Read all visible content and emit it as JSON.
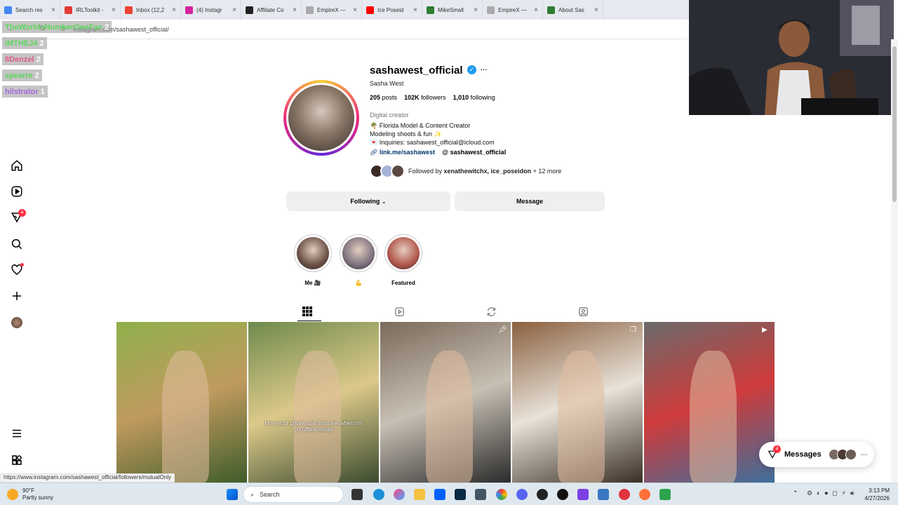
{
  "browser": {
    "tabs": [
      {
        "title": "Search res",
        "color": "#4285f4"
      },
      {
        "title": "IRLToolkit -",
        "color": "#e53935"
      },
      {
        "title": "Inbox (12,2",
        "color": "#ea4335"
      },
      {
        "title": "(4) Instagr",
        "color": "#d6249f"
      },
      {
        "title": "Affiliate Co",
        "color": "#222222"
      },
      {
        "title": "EmpireX —",
        "color": "#aaaaaa"
      },
      {
        "title": "Ice Poseid",
        "color": "#ff0000"
      },
      {
        "title": "MikeSmall",
        "color": "#2e7d32"
      },
      {
        "title": "EmpireX —",
        "color": "#aaaaaa"
      },
      {
        "title": "About Sas",
        "color": "#2e7d32"
      }
    ],
    "url": "instagram.com/sashawest_official/"
  },
  "chat_overlay": [
    {
      "name": "TheWorldsNumberOneFan",
      "count": "2",
      "color": "#5cd65c"
    },
    {
      "name": "IMTHEJ4",
      "count": "2",
      "color": "#5cd65c"
    },
    {
      "name": "8Denzel",
      "count": "2",
      "color": "#e05a8a"
    },
    {
      "name": "spearre",
      "count": "2",
      "color": "#5cd65c"
    },
    {
      "name": "hilstrator",
      "count": "1",
      "color": "#a56bdc"
    }
  ],
  "nav": {
    "notification_badge": "4"
  },
  "profile": {
    "username": "sashawest_official",
    "full_name": "Sasha West",
    "posts_count": "205",
    "posts_label": "posts",
    "followers_count": "102K",
    "followers_label": "followers",
    "following_count": "1,010",
    "following_label": "following",
    "category": "Digital creator",
    "bio_line1": "🌴 Florida Model & Content Creator",
    "bio_line2": "Modeling shoots & fun ✨",
    "bio_line3": "💌 Inquiries: sashawest_official@icloud.com",
    "link": "link.me/sashawest",
    "threads": "sashawest_official",
    "followed_by_prefix": "Followed by ",
    "followed_by_names": "xenathewitchx, ice_poseidon",
    "followed_by_suffix": " + 12 more",
    "following_button": "Following",
    "message_button": "Message"
  },
  "highlights": [
    {
      "label": "Me 🎥",
      "color": "#6b5046"
    },
    {
      "label": "💪",
      "color": "#7f7280"
    },
    {
      "label": "Featured",
      "color": "#b2574c"
    }
  ],
  "posts": [
    {
      "caption": "",
      "colors": [
        "#8fb04b",
        "#c09a5f",
        "#3f5d2a"
      ]
    },
    {
      "caption": "How your phone call finds me when I'm on offline mode",
      "colors": [
        "#6f8a4d",
        "#dcc98a",
        "#3a4a2e"
      ]
    },
    {
      "caption": "",
      "colors": [
        "#7a6a5a",
        "#c8c0b4",
        "#2a2a2a"
      ]
    },
    {
      "caption": "",
      "colors": [
        "#8a6040",
        "#e8e2d8",
        "#3a2f24"
      ]
    },
    {
      "caption": "",
      "colors": [
        "#6a6a6a",
        "#cf3b3b",
        "#3d6f9c"
      ]
    }
  ],
  "messages": {
    "label": "Messages",
    "badge": "4"
  },
  "status_url": "https://www.instagram.com/sashawest_official/followers/mutualOnly",
  "taskbar": {
    "temp": "90°F",
    "weather": "Partly sunny",
    "search": "Search",
    "time": "3:13 PM",
    "date": "4/27/2026"
  }
}
